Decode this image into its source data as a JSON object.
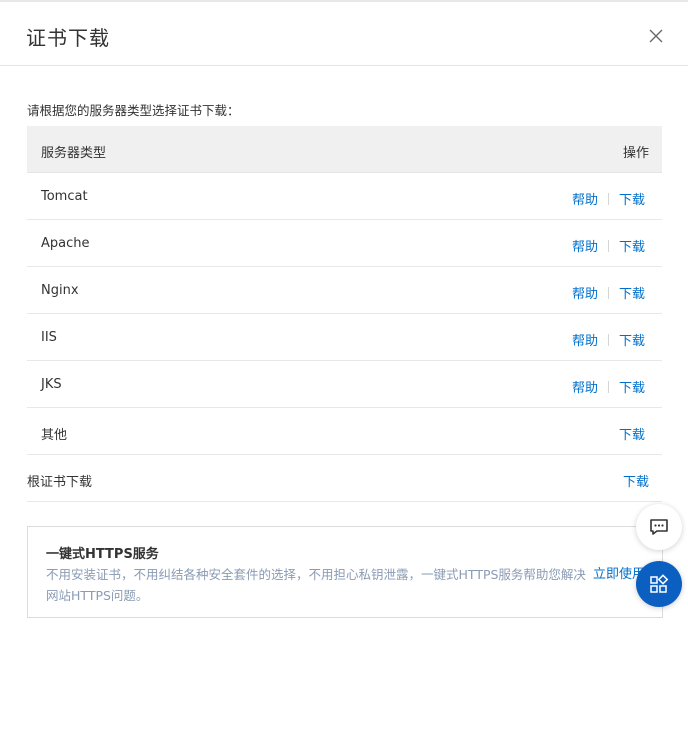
{
  "dialog": {
    "title": "证书下载",
    "close_icon": "close-icon"
  },
  "intro": "请根据您的服务器类型选择证书下载：",
  "table": {
    "headers": {
      "type": "服务器类型",
      "action": "操作"
    },
    "rows": [
      {
        "name": "Tomcat",
        "help": "帮助",
        "download": "下载"
      },
      {
        "name": "Apache",
        "help": "帮助",
        "download": "下载"
      },
      {
        "name": "Nginx",
        "help": "帮助",
        "download": "下载"
      },
      {
        "name": "IIS",
        "help": "帮助",
        "download": "下载"
      },
      {
        "name": "JKS",
        "help": "帮助",
        "download": "下载"
      },
      {
        "name": "其他",
        "download": "下载"
      }
    ],
    "root_row": {
      "name": "根证书下载",
      "download": "下载"
    }
  },
  "promo": {
    "title": "一键式HTTPS服务",
    "description": "不用安装证书，不用纠结各种安全套件的选择，不用担心私钥泄露，一键式HTTPS服务帮助您解决网站HTTPS问题。",
    "link": "立即使用"
  },
  "floating": {
    "chat_icon": "chat-icon",
    "apps_icon": "apps-icon"
  },
  "colors": {
    "link": "#0070cc",
    "header_bg": "#f0f0f0",
    "apps_button": "#0b5fc1",
    "promo_text": "#8a9bb4"
  }
}
